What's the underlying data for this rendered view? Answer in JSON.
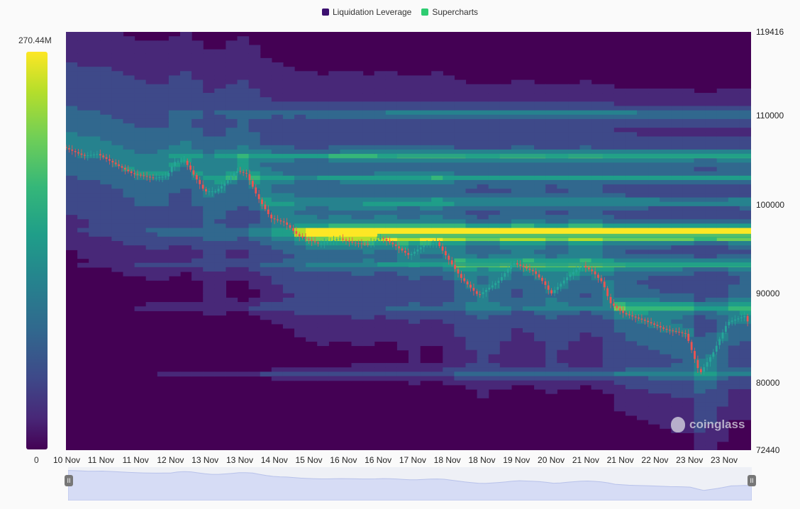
{
  "legend": {
    "items": [
      {
        "label": "Liquidation Leverage",
        "color": "#3b0f6f"
      },
      {
        "label": "Supercharts",
        "color": "#2ecc71"
      }
    ]
  },
  "color_scale": {
    "max_label": "270.44M",
    "min_label": "0"
  },
  "watermark": "coinglass",
  "chart_data": {
    "type": "heatmap",
    "title": "",
    "xlabel": "",
    "ylabel": "",
    "y_ticks": [
      "119416",
      "110000",
      "100000",
      "90000",
      "80000",
      "72440"
    ],
    "y_tick_values": [
      119416,
      110000,
      100000,
      90000,
      80000,
      72440
    ],
    "ylim": [
      72440,
      119416
    ],
    "x_ticks": [
      "10 Nov",
      "11 Nov",
      "11 Nov",
      "12 Nov",
      "13 Nov",
      "13 Nov",
      "14 Nov",
      "15 Nov",
      "16 Nov",
      "16 Nov",
      "17 Nov",
      "18 Nov",
      "18 Nov",
      "19 Nov",
      "20 Nov",
      "21 Nov",
      "21 Nov",
      "22 Nov",
      "23 Nov",
      "23 Nov"
    ],
    "x_tick_days": [
      0,
      0.5,
      1,
      1.5,
      2,
      2.5,
      3,
      3.5,
      4,
      4.5,
      5,
      5.5,
      6,
      6.5,
      7,
      7.5,
      8,
      8.5,
      9,
      9.5
    ],
    "xlim_days": [
      0,
      9.9
    ],
    "price_series": {
      "name": "Supercharts",
      "days": [
        0,
        0.3,
        0.5,
        0.75,
        1.0,
        1.3,
        1.5,
        1.6,
        1.75,
        2.0,
        2.05,
        2.2,
        2.35,
        2.5,
        2.65,
        2.8,
        3.0,
        3.2,
        3.4,
        3.7,
        4.0,
        4.2,
        4.4,
        4.6,
        4.8,
        5.0,
        5.2,
        5.4,
        5.6,
        5.75,
        6.0,
        6.3,
        6.5,
        6.8,
        6.95,
        7.05,
        7.3,
        7.5,
        7.65,
        7.8,
        7.9,
        8.1,
        8.4,
        8.7,
        9.0,
        9.2,
        9.4,
        9.6,
        9.85
      ],
      "prices": [
        106500,
        105500,
        105700,
        104600,
        103500,
        103000,
        103200,
        104800,
        105000,
        102000,
        101500,
        101500,
        102500,
        103800,
        103500,
        101000,
        98500,
        98000,
        96500,
        95600,
        96200,
        95700,
        95600,
        96300,
        95400,
        94300,
        95400,
        95800,
        93500,
        91800,
        89800,
        91500,
        93500,
        92500,
        91200,
        90000,
        92000,
        93200,
        92500,
        91200,
        89000,
        87800,
        87000,
        86000,
        85500,
        81000,
        83500,
        86800,
        87500,
        86300,
        87400,
        86500,
        86800,
        87400,
        87000,
        86900
      ],
      "colors": {
        "up": "#26a69a",
        "down": "#ef5350"
      }
    },
    "liquidation_levels": [
      {
        "price": 105500,
        "intensity": 0.55
      },
      {
        "price": 97000,
        "intensity": 1.0
      },
      {
        "price": 96500,
        "intensity": 0.7
      },
      {
        "price": 93300,
        "intensity": 0.55
      },
      {
        "price": 88500,
        "intensity": 0.45
      },
      {
        "price": 81000,
        "intensity": 0.4
      },
      {
        "price": 110200,
        "intensity": 0.35
      },
      {
        "price": 103000,
        "intensity": 0.35
      },
      {
        "price": 100300,
        "intensity": 0.35
      }
    ]
  }
}
